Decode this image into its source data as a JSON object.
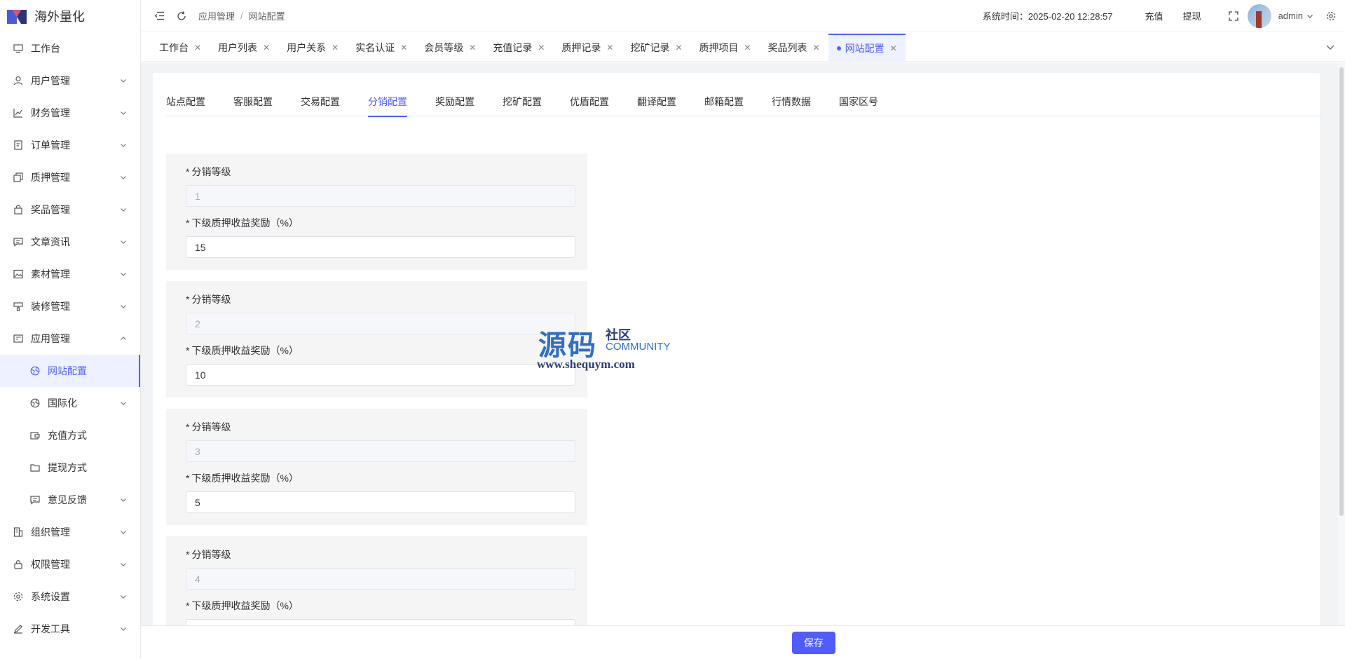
{
  "app": {
    "title": "海外量化"
  },
  "sidebar": {
    "items": [
      {
        "label": "工作台",
        "icon": "monitor-icon"
      },
      {
        "label": "用户管理",
        "icon": "user-icon"
      },
      {
        "label": "财务管理",
        "icon": "chart-icon"
      },
      {
        "label": "订单管理",
        "icon": "order-icon"
      },
      {
        "label": "质押管理",
        "icon": "copy-icon"
      },
      {
        "label": "奖品管理",
        "icon": "bag-icon"
      },
      {
        "label": "文章资讯",
        "icon": "message-icon"
      },
      {
        "label": "素材管理",
        "icon": "image-icon"
      },
      {
        "label": "装修管理",
        "icon": "brush-icon"
      },
      {
        "label": "应用管理",
        "icon": "app-icon"
      },
      {
        "label": "网站配置",
        "icon": "globe-icon"
      },
      {
        "label": "国际化",
        "icon": "globe-icon"
      },
      {
        "label": "充值方式",
        "icon": "wallet-icon"
      },
      {
        "label": "提现方式",
        "icon": "folder-icon"
      },
      {
        "label": "意见反馈",
        "icon": "message-icon"
      },
      {
        "label": "组织管理",
        "icon": "building-icon"
      },
      {
        "label": "权限管理",
        "icon": "lock-icon"
      },
      {
        "label": "系统设置",
        "icon": "gear-icon"
      },
      {
        "label": "开发工具",
        "icon": "pen-icon"
      }
    ]
  },
  "header": {
    "breadcrumb": [
      "应用管理",
      "网站配置"
    ],
    "breadcrumb_sep": "/",
    "system_time_label": "系统时间：2025-02-20 12:28:57",
    "recharge": "充值",
    "withdraw": "提现",
    "username": "admin"
  },
  "tabs": [
    "工作台",
    "用户列表",
    "用户关系",
    "实名认证",
    "会员等级",
    "充值记录",
    "质押记录",
    "挖矿记录",
    "质押项目",
    "奖品列表",
    "网站配置"
  ],
  "config_tabs": [
    "站点配置",
    "客服配置",
    "交易配置",
    "分销配置",
    "奖励配置",
    "挖矿配置",
    "优盾配置",
    "翻译配置",
    "邮箱配置",
    "行情数据",
    "国家区号"
  ],
  "config_active": "分销配置",
  "levels": {
    "level_label": "分销等级",
    "reward_label": "下级质押收益奖励（%）",
    "required_mark": "*",
    "items": [
      {
        "level": "1",
        "reward": "15"
      },
      {
        "level": "2",
        "reward": "10"
      },
      {
        "level": "3",
        "reward": "5"
      },
      {
        "level": "4",
        "reward": ""
      }
    ]
  },
  "watermark": {
    "big": "源码",
    "small": "社区",
    "community": "COMMUNITY",
    "url": "www.shequym.com"
  },
  "footer": {
    "save_label": "保存"
  },
  "colors": {
    "accent": "#5060ff",
    "save_button": "#4f5dff"
  }
}
